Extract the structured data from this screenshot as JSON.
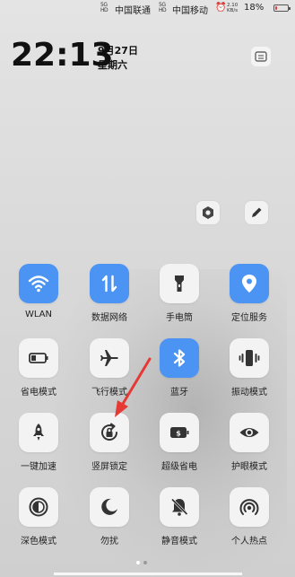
{
  "status_bar": {
    "carrier1": "中国联通",
    "carrier2": "中国移动",
    "signal_label": "5G HD",
    "net_speed": "2.10",
    "net_speed_unit": "KB/s",
    "battery": "18%",
    "battery_level": 0.18,
    "battery_color": "#e53935"
  },
  "clock": {
    "time": "22:13",
    "date": "9月27日",
    "weekday": "星期六"
  },
  "accent_color": "#4b94f3",
  "tiles": [
    {
      "label": "WLAN",
      "icon": "wifi-icon",
      "active": true
    },
    {
      "label": "数据网络",
      "icon": "mobile-data-icon",
      "active": true
    },
    {
      "label": "手电筒",
      "icon": "flashlight-icon",
      "active": false
    },
    {
      "label": "定位服务",
      "icon": "location-icon",
      "active": true
    },
    {
      "label": "省电模式",
      "icon": "battery-saver-icon",
      "active": false
    },
    {
      "label": "飞行模式",
      "icon": "airplane-icon",
      "active": false
    },
    {
      "label": "蓝牙",
      "icon": "bluetooth-icon",
      "active": true
    },
    {
      "label": "振动模式",
      "icon": "vibrate-icon",
      "active": false
    },
    {
      "label": "一键加速",
      "icon": "rocket-icon",
      "active": false
    },
    {
      "label": "竖屏锁定",
      "icon": "rotation-lock-icon",
      "active": false
    },
    {
      "label": "超级省电",
      "icon": "super-saver-icon",
      "active": false
    },
    {
      "label": "护眼模式",
      "icon": "eye-icon",
      "active": false
    },
    {
      "label": "深色模式",
      "icon": "dark-mode-icon",
      "active": false
    },
    {
      "label": "勿扰",
      "icon": "moon-icon",
      "active": false
    },
    {
      "label": "静音模式",
      "icon": "mute-icon",
      "active": false
    },
    {
      "label": "个人热点",
      "icon": "hotspot-icon",
      "active": false
    }
  ],
  "page_indicator": {
    "current": 1,
    "total": 2
  },
  "annotation": {
    "type": "red-arrow",
    "color": "#e53935"
  }
}
